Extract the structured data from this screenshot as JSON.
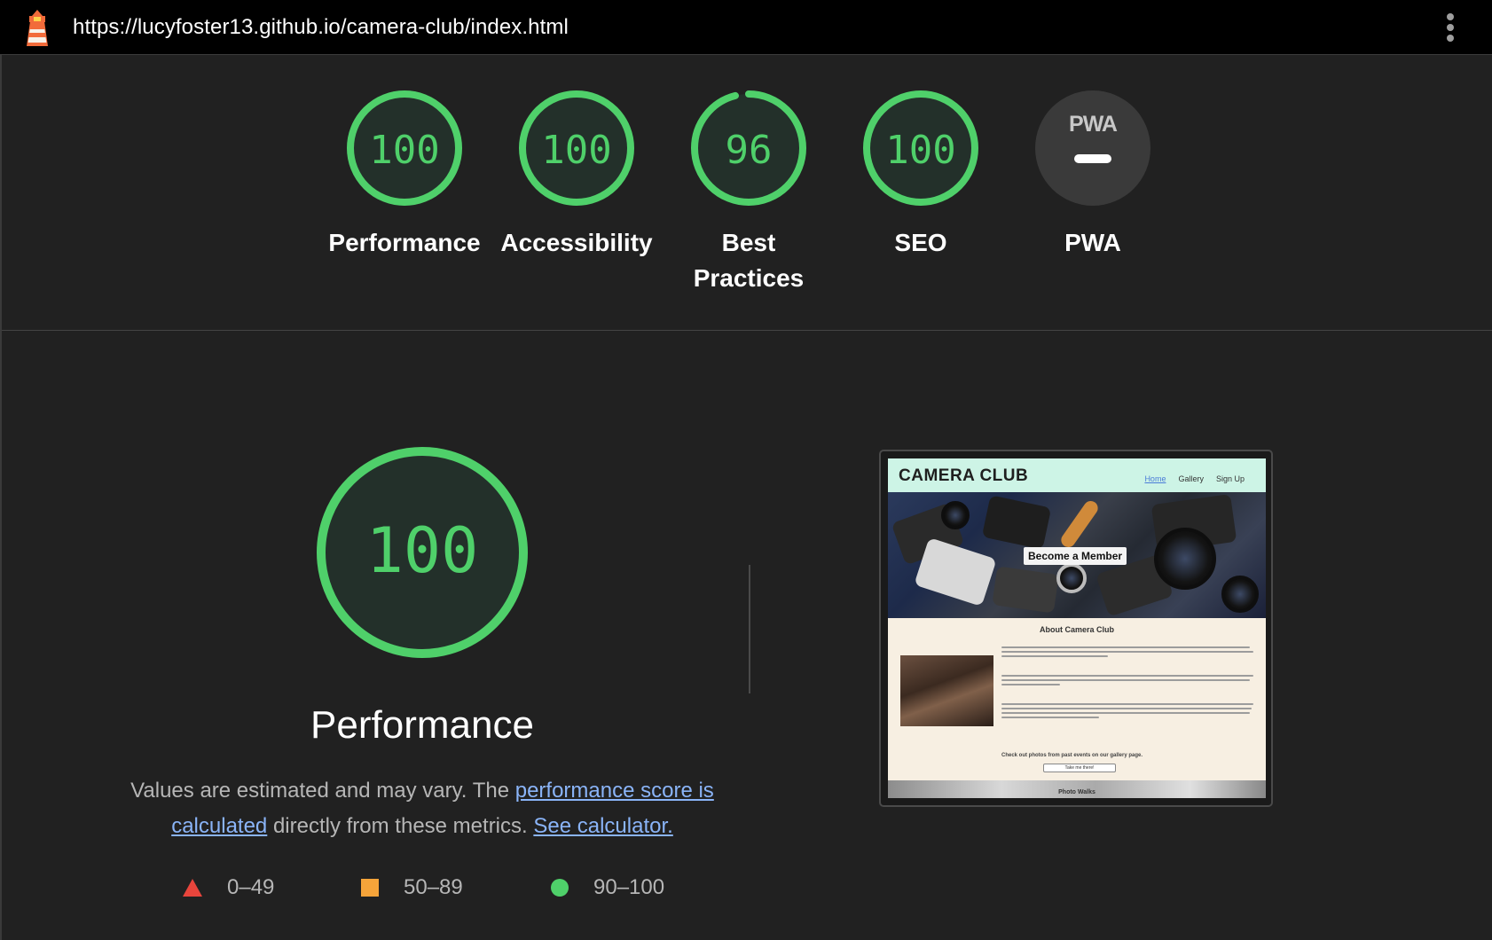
{
  "topbar": {
    "url": "https://lucyfoster13.github.io/camera-club/index.html",
    "logo_icon": "lighthouse-icon",
    "menu_icon": "more-vertical-icon"
  },
  "categories": [
    {
      "label": "Performance",
      "score": "100",
      "fraction": 1.0,
      "color": "#4fd06a"
    },
    {
      "label": "Accessibility",
      "score": "100",
      "fraction": 1.0,
      "color": "#4fd06a"
    },
    {
      "label": "Best Practices",
      "score": "96",
      "fraction": 0.96,
      "color": "#4fd06a"
    },
    {
      "label": "SEO",
      "score": "100",
      "fraction": 1.0,
      "color": "#4fd06a"
    },
    {
      "label": "PWA",
      "badge": "PWA"
    }
  ],
  "main": {
    "score": "100",
    "fraction": 1.0,
    "title": "Performance",
    "desc_prefix": "Values are estimated and may vary. The ",
    "link_score": "performance score is calculated",
    "desc_middle": " directly from these metrics. ",
    "link_calc": "See calculator."
  },
  "legend": [
    {
      "range": "0–49",
      "color": "#e8453c",
      "shape": "triangle"
    },
    {
      "range": "50–89",
      "color": "#f5a43a",
      "shape": "square"
    },
    {
      "range": "90–100",
      "color": "#4fd06a",
      "shape": "circle"
    }
  ],
  "screenshot": {
    "brand": "CAMERA CLUB",
    "nav": [
      "Home",
      "Gallery",
      "Sign Up"
    ],
    "cta": "Become a Member",
    "about_heading": "About Camera Club",
    "check_text": "Check out photos from past events on our gallery page.",
    "button": "Take me there!",
    "strip_label": "Photo Walks"
  },
  "colors": {
    "background": "#212121",
    "pass": "#4fd06a",
    "link": "#8ab4f8"
  }
}
